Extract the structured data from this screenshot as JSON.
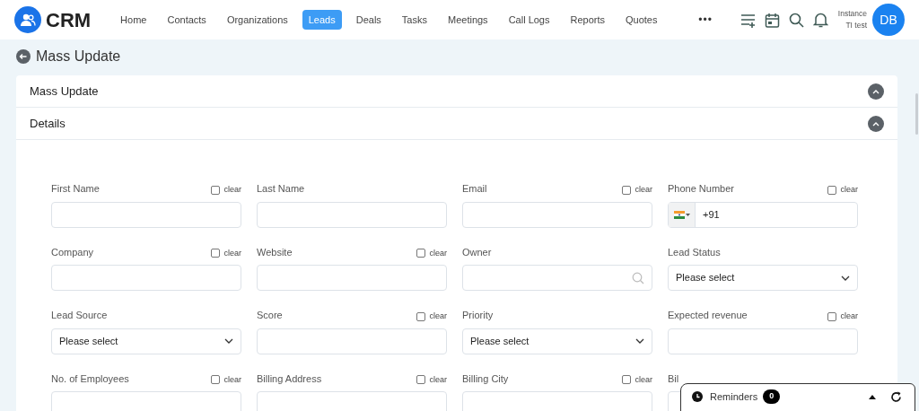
{
  "brand": "CRM",
  "nav": [
    {
      "label": "Home",
      "selected": false
    },
    {
      "label": "Contacts",
      "selected": false
    },
    {
      "label": "Organizations",
      "selected": false
    },
    {
      "label": "Leads",
      "selected": true
    },
    {
      "label": "Deals",
      "selected": false
    },
    {
      "label": "Tasks",
      "selected": false
    },
    {
      "label": "Meetings",
      "selected": false
    },
    {
      "label": "Call Logs",
      "selected": false
    },
    {
      "label": "Reports",
      "selected": false
    },
    {
      "label": "Quotes",
      "selected": false
    }
  ],
  "more": "•••",
  "user": {
    "line1": "Instance",
    "line2": "TI test",
    "initials": "DB"
  },
  "page_title": "Mass Update",
  "sections": [
    {
      "title": "Mass Update",
      "expanded": true
    },
    {
      "title": "Details",
      "expanded": true
    }
  ],
  "fields": [
    {
      "label": "First Name",
      "kind": "text",
      "clear": {
        "label": "clear",
        "checked": false
      }
    },
    {
      "label": "Last Name",
      "kind": "text"
    },
    {
      "label": "Email",
      "kind": "text",
      "clear": {
        "label": "clear",
        "checked": false
      }
    },
    {
      "label": "Phone Number",
      "kind": "phone",
      "value": "+91",
      "clear": {
        "label": "clear",
        "checked": false
      }
    },
    {
      "label": "Company",
      "kind": "text",
      "clear": {
        "label": "clear",
        "checked": false
      }
    },
    {
      "label": "Website",
      "kind": "text",
      "clear": {
        "label": "clear",
        "checked": false
      }
    },
    {
      "label": "Owner",
      "kind": "lookup"
    },
    {
      "label": "Lead Status",
      "kind": "select",
      "value": "Please select"
    },
    {
      "label": "Lead Source",
      "kind": "select",
      "value": "Please select"
    },
    {
      "label": "Score",
      "kind": "text",
      "clear": {
        "label": "clear",
        "checked": false
      }
    },
    {
      "label": "Priority",
      "kind": "select",
      "value": "Please select"
    },
    {
      "label": "Expected revenue",
      "kind": "text",
      "clear": {
        "label": "clear",
        "checked": false
      }
    },
    {
      "label": "No. of Employees",
      "kind": "text",
      "clear": {
        "label": "clear",
        "checked": false
      }
    },
    {
      "label": "Billing Address",
      "kind": "text",
      "clear": {
        "label": "clear",
        "checked": false
      }
    },
    {
      "label": "Billing City",
      "kind": "text",
      "clear": {
        "label": "clear",
        "checked": false
      }
    },
    {
      "label": "Bil",
      "kind": "text"
    }
  ],
  "reminders": {
    "label": "Reminders",
    "count": "0"
  }
}
